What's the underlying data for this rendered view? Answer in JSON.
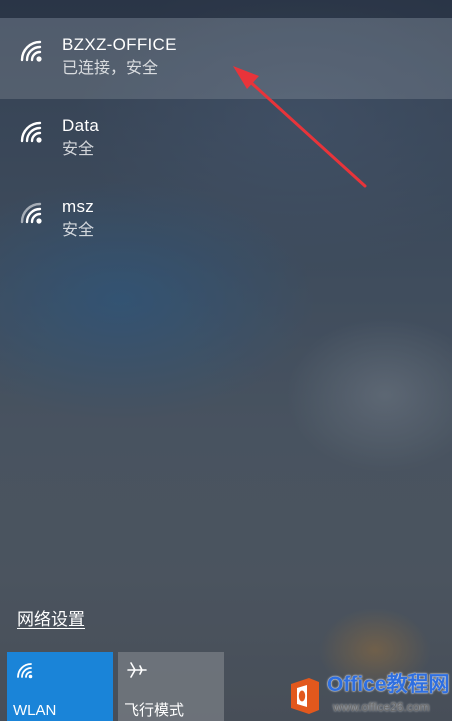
{
  "networks": [
    {
      "name": "BZXZ-OFFICE",
      "status": "已连接，安全",
      "connected": true,
      "icon": "wifi-icon"
    },
    {
      "name": "Data",
      "status": "安全",
      "connected": false,
      "icon": "wifi-icon"
    },
    {
      "name": "msz",
      "status": "安全",
      "connected": false,
      "icon": "wifi-icon"
    }
  ],
  "settings_link": "网络设置",
  "quick_actions": [
    {
      "label": "WLAN",
      "icon": "wifi-icon",
      "active": true,
      "color": "#1a84d8"
    },
    {
      "label": "飞行模式",
      "icon": "airplane-icon",
      "active": false
    }
  ],
  "annotation_arrow_color": "#e8343a",
  "watermark": {
    "title": "Office教程网",
    "url": "www.office26.com",
    "logo_color": "#e2581d"
  }
}
